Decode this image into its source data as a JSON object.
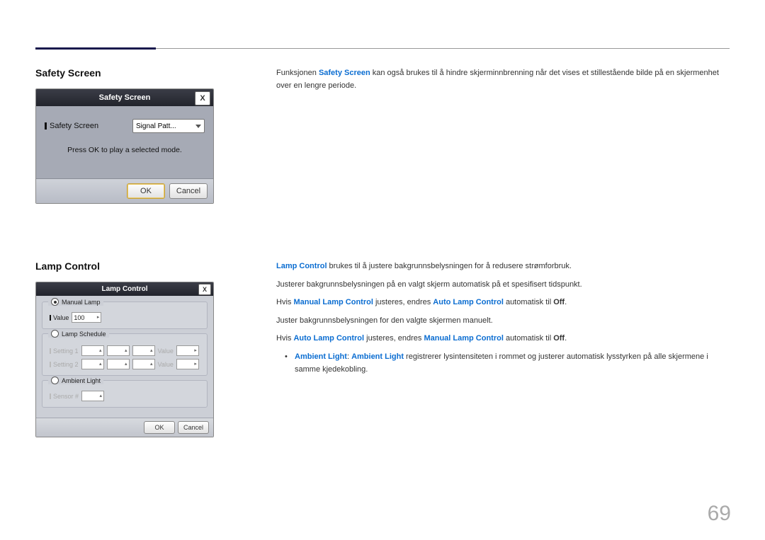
{
  "sectionA": {
    "heading": "Safety Screen",
    "desc_pre": "Funksjonen ",
    "desc_highlight": "Safety Screen",
    "desc_post": " kan også brukes til å hindre skjerminnbrenning når det vises et stillestående bilde på en skjermenhet over en lengre periode.",
    "dialog": {
      "title": "Safety Screen",
      "close": "X",
      "label": "Safety Screen",
      "combo": "Signal Patt...",
      "hint": "Press OK to play a selected mode.",
      "ok": "OK",
      "cancel": "Cancel"
    }
  },
  "sectionB": {
    "heading": "Lamp Control",
    "p1_highlight": "Lamp Control",
    "p1_rest": " brukes til å justere bakgrunnsbelysningen for å redusere strømforbruk.",
    "p2": "Justerer bakgrunnsbelysningen på en valgt skjerm automatisk på et spesifisert tidspunkt.",
    "p3_pre": "Hvis ",
    "p3_h1": "Manual Lamp Control",
    "p3_mid": " justeres, endres ",
    "p3_h2": "Auto Lamp Control",
    "p3_mid2": " automatisk til ",
    "p3_off": "Off",
    "p3_end": ".",
    "p4": "Juster bakgrunnsbelysningen for den valgte skjermen manuelt.",
    "p5_pre": "Hvis ",
    "p5_h1": "Auto Lamp Control",
    "p5_mid": " justeres, endres ",
    "p5_h2": "Manual Lamp Control",
    "p5_mid2": " automatisk til ",
    "p5_off": "Off",
    "p5_end": ".",
    "bullet_h1": "Ambient Light",
    "bullet_sep": ": ",
    "bullet_h2": "Ambient Light",
    "bullet_rest": " registrerer lysintensiteten i rommet og justerer automatisk lysstyrken på alle skjermene i samme kjedekobling.",
    "bullet_mark": "•",
    "dialog": {
      "title": "Lamp Control",
      "close": "X",
      "grp1": "Manual Lamp",
      "value_label": "Value",
      "value": "100",
      "grp2": "Lamp Schedule",
      "setting1": "Setting 1",
      "setting2": "Setting 2",
      "value_dis": "Value",
      "grp3": "Ambient Light",
      "sensor": "Sensor #",
      "ok": "OK",
      "cancel": "Cancel"
    }
  },
  "pageNumber": "69"
}
